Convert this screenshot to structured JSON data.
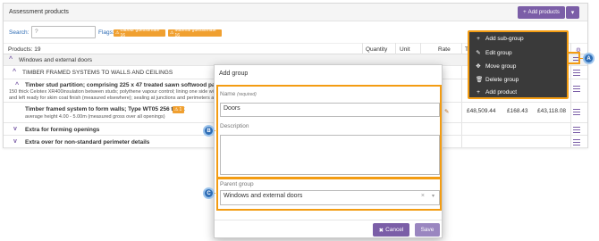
{
  "panel": {
    "title": "Assessment products",
    "add_products_label": "Add products",
    "caret": "▾"
  },
  "search": {
    "label": "Search:",
    "value": "?"
  },
  "flags": {
    "label": "Flags:",
    "items": [
      "Labour guesstimate 16",
      "Material guesstimate 16"
    ]
  },
  "table": {
    "products_count": "Products: 19",
    "headers": {
      "quantity": "Quantity",
      "unit": "Unit",
      "rate": "Rate",
      "total_partial": "T"
    },
    "rows": [
      {
        "label": "Windows and external doors"
      },
      {
        "label": "TIMBER FRAMED SYSTEMS TO WALLS AND CEILINGS"
      },
      {
        "label": "Timber stud partition; comprising 225 x 47 treated sawn softwood partition men",
        "desc1": "150 thick Celotex XR400insulation between studs; polythene vapour control; lining one side with",
        "desc2": "and left ready for skim coat finish (measured elsewhere); sealing at junctions and perimeters a"
      },
      {
        "label": "Timber framed system to form walls; Type WT05 256 thick",
        "flag": "1",
        "desc1": "average height 4.00 - 5.00m (measured gross over all openings)",
        "amount1": "£48,509.44",
        "amount2": "£168.43",
        "amount3": "£43,118.08"
      },
      {
        "label": "Extra for forming openings"
      },
      {
        "label": "Extra over for non-standard perimeter details"
      }
    ]
  },
  "dropdown": {
    "items": [
      {
        "icon": "+",
        "label": "Add sub-group"
      },
      {
        "icon": "✎",
        "label": "Edit group"
      },
      {
        "icon": "✥",
        "label": "Move group"
      },
      {
        "icon": "🗑",
        "label": "Delete group"
      },
      {
        "icon": "+",
        "label": "Add product"
      }
    ]
  },
  "modal": {
    "title": "Add group",
    "name_label": "Name",
    "name_required": "(required)",
    "name_value": "Doors",
    "description_label": "Description",
    "description_value": "",
    "parent_label": "Parent group",
    "parent_value": "Windows and external doors",
    "clear_glyph": "×",
    "caret_glyph": "▾",
    "cancel_label": "Cancel",
    "save_label": "Save"
  },
  "callouts": {
    "a": "A",
    "b": "B",
    "c": "C"
  },
  "colors": {
    "accent": "#7b5ea7",
    "highlight": "#f39c12",
    "callout": "#2f6db5",
    "flag": "#f0a030",
    "menu_bg": "#3a3a3a"
  }
}
